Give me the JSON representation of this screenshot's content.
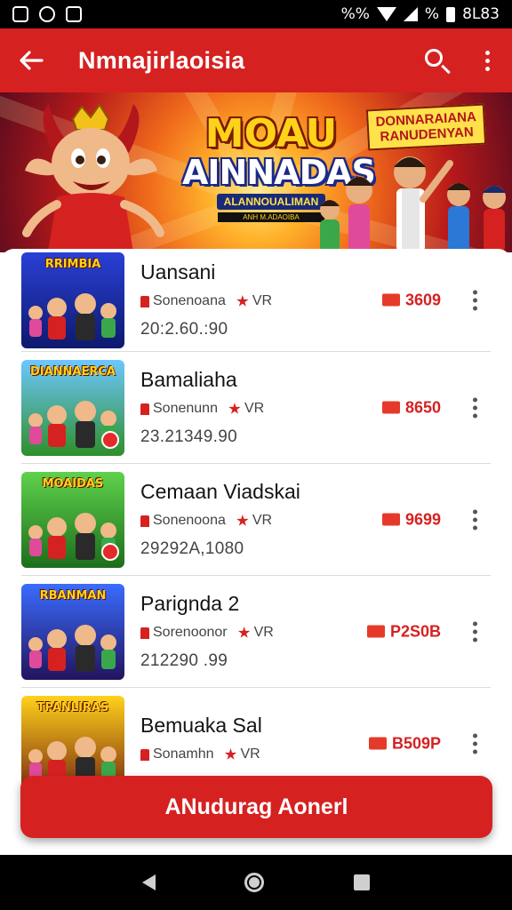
{
  "status_bar": {
    "left_icons": [
      "image-icon",
      "whatsapp-icon",
      "image-icon"
    ],
    "battery_text": "%%",
    "percent_text": "%",
    "time": "8L83"
  },
  "app_bar": {
    "title": "Nmnajirlaoisia"
  },
  "banner": {
    "title_line1": "MOAU",
    "title_line2": "AINNADAS",
    "subtitle": "ALANNOUALIMAN",
    "subtitle_small": "ANH M.ADAOIBA",
    "tag_line1": "DONNARAIANA",
    "tag_line2": "RANUDENYAN"
  },
  "items": [
    {
      "thumb_title": "RRIMBIA",
      "name": "Uansani",
      "meta_left": "Sonenoana",
      "meta_right": "VR",
      "count": "20:2.60.:90",
      "price": "3609",
      "thumb_bg": [
        "#2a3fd6",
        "#0d1a6e"
      ]
    },
    {
      "thumb_title": "DIANNAERCA",
      "name": "Bamaliaha",
      "meta_left": "Sonenunn",
      "meta_right": "VR",
      "count": "23.21349.90",
      "price": "8650",
      "thumb_bg": [
        "#6cc7ff",
        "#2e8f2a"
      ]
    },
    {
      "thumb_title": "MOAIDAS",
      "name": "Cemaan Viadskai",
      "meta_left": "Sonenoona",
      "meta_right": "VR",
      "count": "29292A,1080",
      "price": "9699",
      "thumb_bg": [
        "#5fd14c",
        "#1c6e1b"
      ]
    },
    {
      "thumb_title": "RBANMAN",
      "name": "Parignda 2",
      "meta_left": "Sorenoonor",
      "meta_right": "VR",
      "count": "212290 .99",
      "price": "P2S0B",
      "thumb_bg": [
        "#3a6cff",
        "#22145e"
      ]
    },
    {
      "thumb_title": "TPANLIRAS",
      "name": "Bemuaka Sal",
      "meta_left": "Sonamhn",
      "meta_right": "VR",
      "count": "",
      "price": "B509P",
      "thumb_bg": [
        "#ffd21a",
        "#7a2a10"
      ]
    }
  ],
  "cta": {
    "label": "ANudurag Aonerl"
  }
}
